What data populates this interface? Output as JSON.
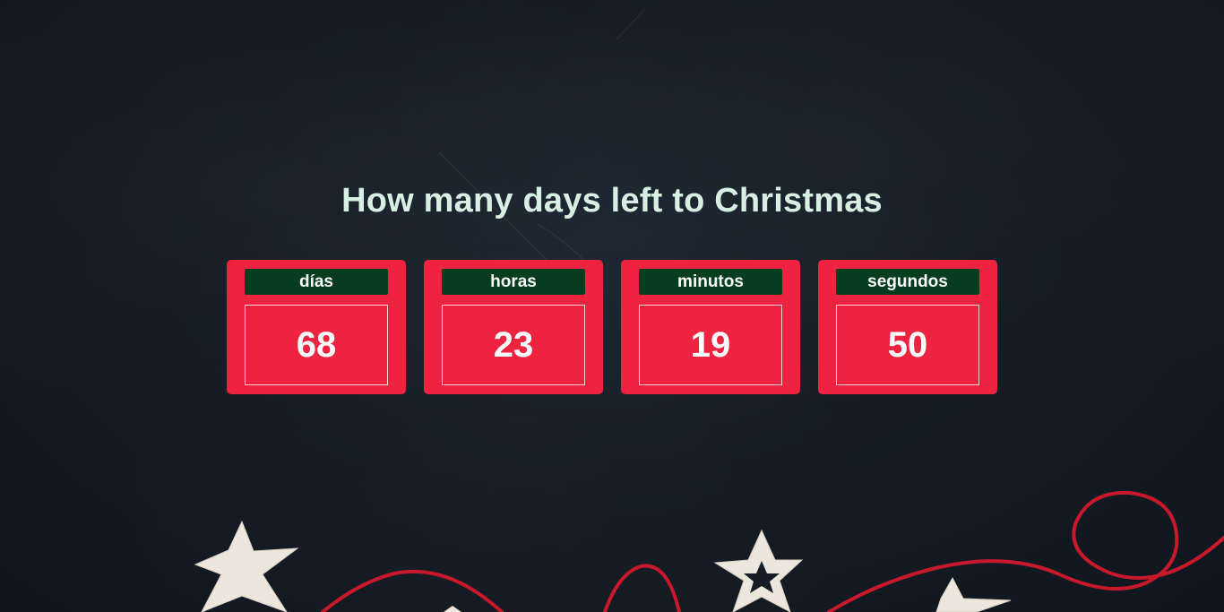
{
  "page": {
    "title": "How many days left to Christmas"
  },
  "countdown": [
    {
      "label": "días",
      "value": "68"
    },
    {
      "label": "horas",
      "value": "23"
    },
    {
      "label": "minutos",
      "value": "19"
    },
    {
      "label": "segundos",
      "value": "50"
    }
  ],
  "colors": {
    "background": "#151c25",
    "title": "#d8efe4",
    "card": "#ee2340",
    "label_bg": "#053d1e",
    "yarn": "#c8182b",
    "star": "#ece6dc"
  },
  "decorations": {
    "icons": [
      "star-icon",
      "yarn-string"
    ]
  }
}
